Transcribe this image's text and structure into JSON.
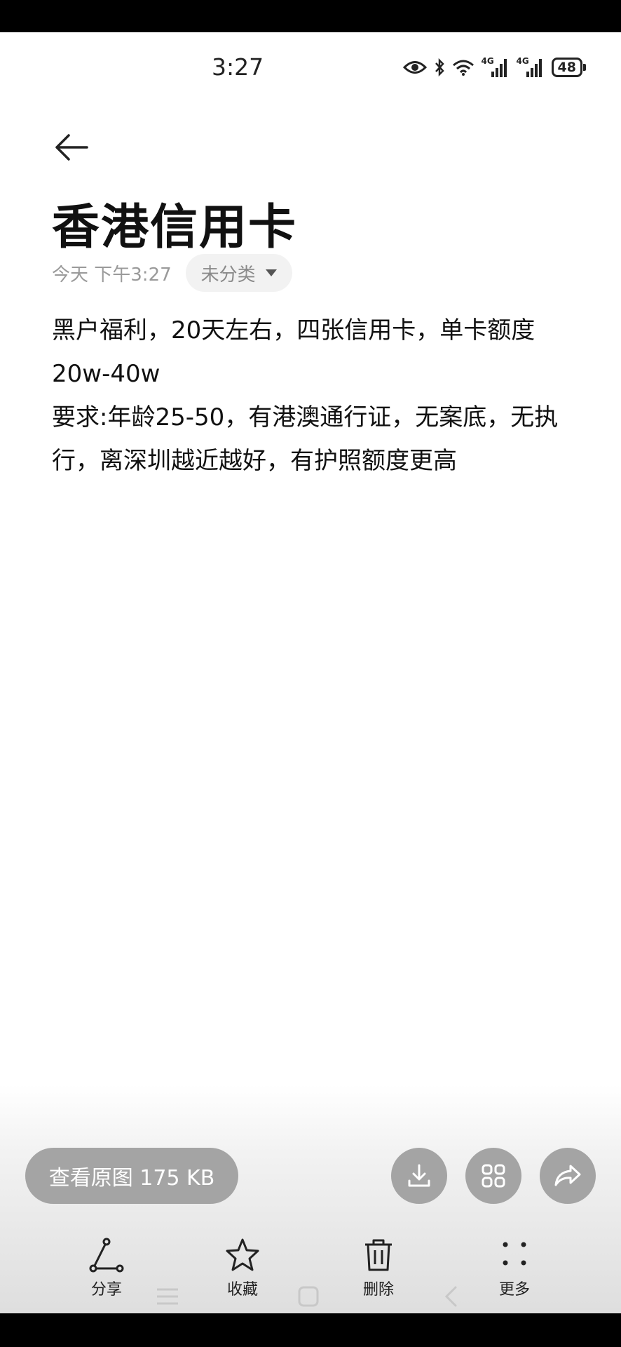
{
  "status_bar": {
    "time": "3:27",
    "battery": "48",
    "network_1": "4G",
    "network_2": "4G"
  },
  "note": {
    "title": "香港信用卡",
    "date": "今天 下午3:27",
    "category": "未分类",
    "body_lines": [
      "黑户福利，20天左右，四张信用卡，单卡额度20w-40w",
      "要求:年龄25-50，有港澳通行证，无案底，无执行，离深圳越近越好，有护照额度更高"
    ]
  },
  "image_bar": {
    "view_original": "查看原图 175 KB"
  },
  "actions": {
    "share": "分享",
    "favorite": "收藏",
    "delete": "删除",
    "more": "更多"
  },
  "icons": [
    "back-arrow-icon",
    "download-icon",
    "grid-icon",
    "forward-icon",
    "share-icon",
    "star-icon",
    "trash-icon",
    "more-icon"
  ]
}
